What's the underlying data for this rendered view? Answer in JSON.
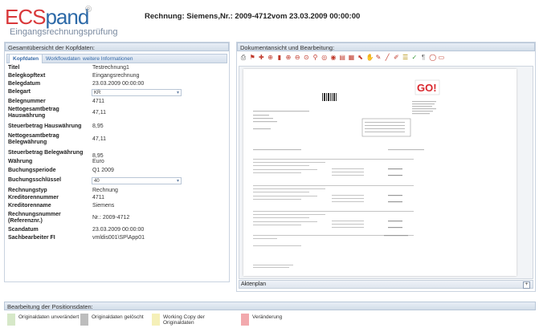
{
  "logo": {
    "ecs": "ECS",
    "pand": "pand",
    "reg": "®",
    "sub": "Eingangsrechnungsprüfung"
  },
  "header": {
    "title": "Rechnung: Siemens,Nr.: 2009-4712vom 23.03.2009 00:00:00"
  },
  "left": {
    "section_title": "Gesamtübersicht der Kopfdaten:",
    "tabs": [
      "Kopfdaten",
      "Workflowdaten",
      "weitere Informationen"
    ],
    "fields": [
      {
        "label": "Titel",
        "value": "Testrechnung1"
      },
      {
        "label": "Belegkopftext",
        "value": "Eingangsrechnung"
      },
      {
        "label": "Belegdatum",
        "value": "23.03.2009 00:00:00"
      },
      {
        "label": "Belegart",
        "value": "KR",
        "select": true
      },
      {
        "label": "Belegnummer",
        "value": "4711"
      },
      {
        "label": "Nettogesamtbetrag Hauswährung",
        "value": "47,11"
      },
      {
        "label": "Steuerbetrag Hauswährung",
        "value": "8,95"
      },
      {
        "label": "Nettogesamtbetrag Belegwährung",
        "value": "47,11"
      },
      {
        "label": "Steuerbetrag Belegwährung",
        "value": "8,95"
      },
      {
        "label": "Währung",
        "value": "Euro"
      },
      {
        "label": "Buchungsperiode",
        "value": "Q1 2009"
      },
      {
        "label": "Buchungsschlüssel",
        "value": "40",
        "select": true
      },
      {
        "label": "Rechnungstyp",
        "value": "Rechnung"
      },
      {
        "label": "Kreditorennummer",
        "value": "4711"
      },
      {
        "label": "Kreditorenname",
        "value": "Siemens"
      },
      {
        "label": "Rechnungsnummer (Referenznr.)",
        "value": "Nr.: 2009-4712"
      },
      {
        "label": "Scandatum",
        "value": "23.03.2009 00:00:00"
      },
      {
        "label": "Sachbearbeiter FI",
        "value": "vmldis001\\SP\\App01"
      }
    ]
  },
  "right": {
    "section_title": "Dokumentansicht und Bearbeitung:",
    "aktenplan": "Aktenplan",
    "doc": {
      "logo": "GO!"
    }
  },
  "bottom": {
    "section_title": "Bearbeitung der Positionsdaten:",
    "legend": [
      {
        "label": "Originaldaten unverändert",
        "color": "#d6e8c8"
      },
      {
        "label": "Originaldaten gelöscht",
        "color": "#bdbdbd"
      },
      {
        "label": "Working Copy der Originaldaten",
        "color": "#f5f0b8"
      },
      {
        "label": "Veränderung",
        "color": "#f2a9ad"
      }
    ]
  },
  "colors": {
    "accent": "#2d6aa8",
    "logo_red": "#d9383a",
    "header_bg": "#d3dde9"
  }
}
